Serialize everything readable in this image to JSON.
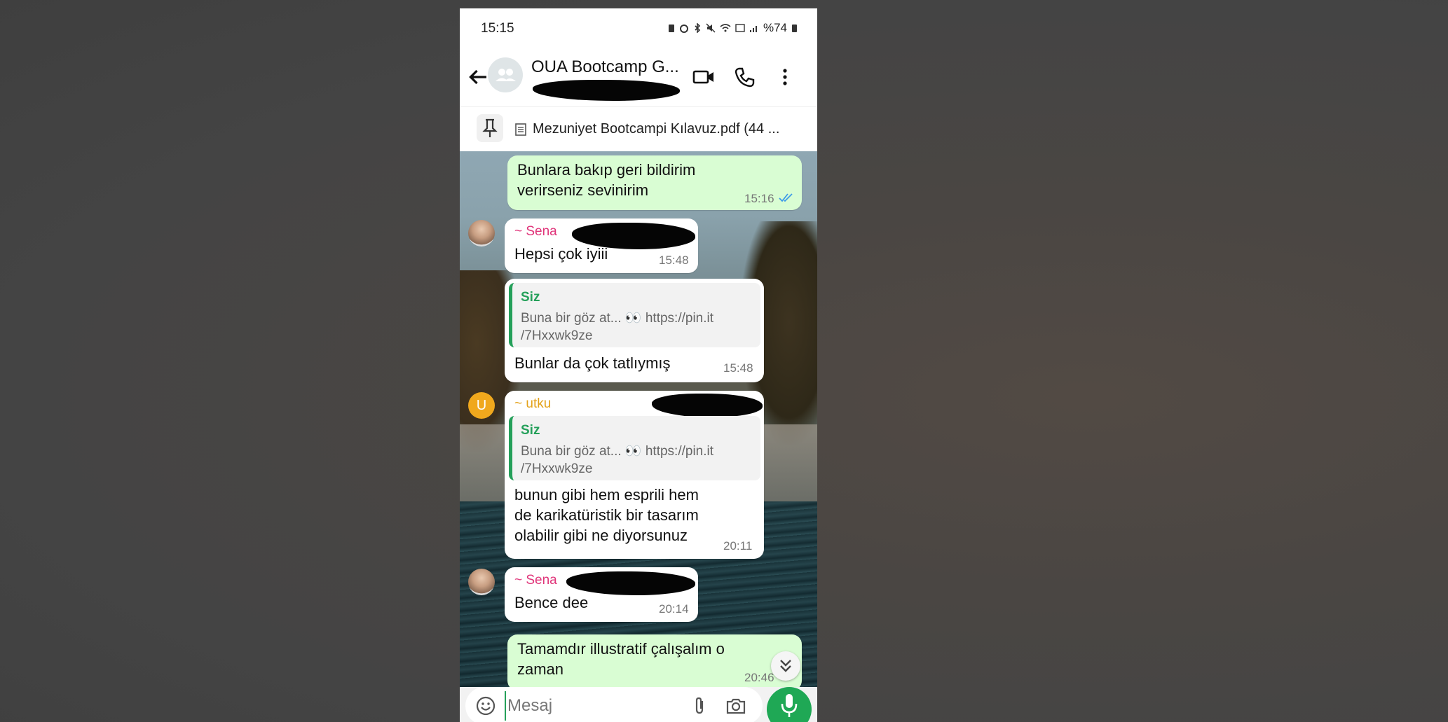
{
  "status": {
    "time": "15:15",
    "battery": "%74"
  },
  "header": {
    "title": "OUA Bootcamp G..."
  },
  "pinned": {
    "text": "Mezuniyet Bootcampi Kılavuz.pdf (44 ..."
  },
  "messages": [
    {
      "id": "m1",
      "type": "out",
      "text1": "Bunlara bakıp geri bildirim",
      "text2": "verirseniz sevinirim",
      "time": "15:16"
    },
    {
      "id": "m2",
      "type": "in",
      "sender": "~ Sena",
      "text": "Hepsi çok iyiii",
      "time": "15:48"
    },
    {
      "id": "m3",
      "type": "in",
      "quote_name": "Siz",
      "quote_line1": "Buna bir göz at... 👀 https://pin.it",
      "quote_line2": "/7Hxxwk9ze",
      "text": "Bunlar da çok tatlıymış",
      "time": "15:48"
    },
    {
      "id": "m4",
      "type": "in",
      "sender": "~ utku",
      "avatar_letter": "U",
      "quote_name": "Siz",
      "quote_line1": "Buna bir göz at... 👀 https://pin.it",
      "quote_line2": "/7Hxxwk9ze",
      "text1": "bunun gibi hem esprili hem",
      "text2": "de karikatüristik bir tasarım",
      "text3": "olabilir gibi ne diyorsunuz",
      "time": "20:11"
    },
    {
      "id": "m5",
      "type": "in",
      "sender": "~ Sena",
      "text": "Bence dee",
      "time": "20:14"
    },
    {
      "id": "m6",
      "type": "out",
      "text1": "Tamamdır illustratif çalışalım o",
      "text2": "zaman",
      "time": "20:46"
    }
  ],
  "input": {
    "placeholder": "Mesaj"
  },
  "colors": {
    "outgoing_bubble": "#d9fdd3",
    "accent_green": "#1fa855",
    "sena_name": "#e0357a",
    "utku_name": "#e3a21a",
    "read_ticks": "#3d9be9"
  }
}
